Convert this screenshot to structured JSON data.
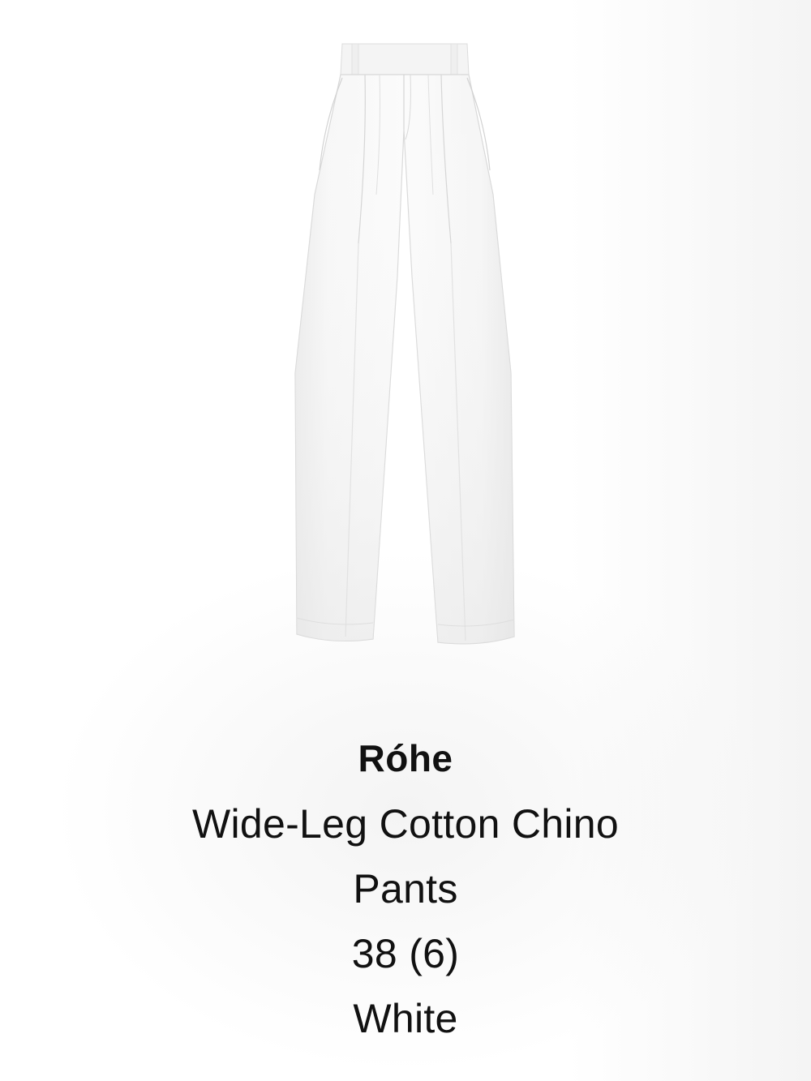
{
  "product": {
    "brand": "Róhe",
    "name": "Wide-Leg Cotton Chino Pants",
    "size": "38 (6)",
    "color": "White",
    "image_alt": "white wide-leg pleated trousers"
  }
}
